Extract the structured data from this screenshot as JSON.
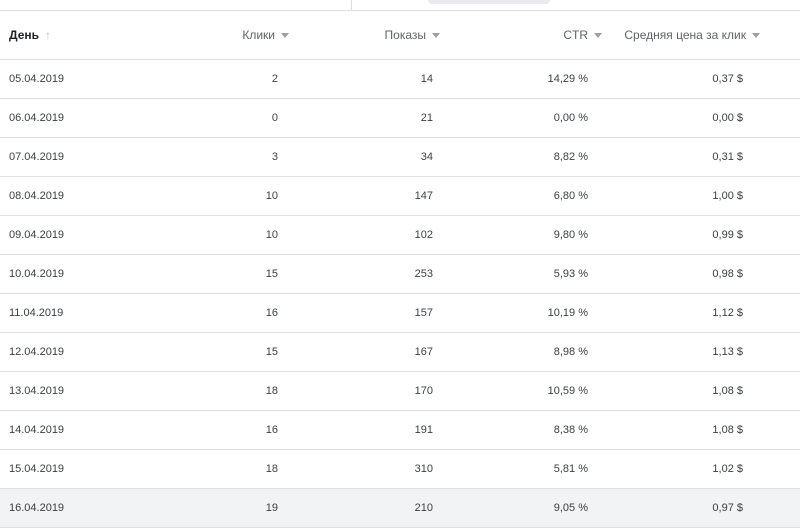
{
  "table": {
    "headers": {
      "day": "День",
      "clicks": "Клики",
      "impressions": "Показы",
      "ctr": "CTR",
      "cpc": "Средняя цена за клик"
    },
    "rows": [
      {
        "day": "05.04.2019",
        "clicks": "2",
        "impressions": "14",
        "ctr": "14,29 %",
        "cpc": "0,37 $"
      },
      {
        "day": "06.04.2019",
        "clicks": "0",
        "impressions": "21",
        "ctr": "0,00 %",
        "cpc": "0,00 $"
      },
      {
        "day": "07.04.2019",
        "clicks": "3",
        "impressions": "34",
        "ctr": "8,82 %",
        "cpc": "0,31 $"
      },
      {
        "day": "08.04.2019",
        "clicks": "10",
        "impressions": "147",
        "ctr": "6,80 %",
        "cpc": "1,00 $"
      },
      {
        "day": "09.04.2019",
        "clicks": "10",
        "impressions": "102",
        "ctr": "9,80 %",
        "cpc": "0,99 $"
      },
      {
        "day": "10.04.2019",
        "clicks": "15",
        "impressions": "253",
        "ctr": "5,93 %",
        "cpc": "0,98 $"
      },
      {
        "day": "11.04.2019",
        "clicks": "16",
        "impressions": "157",
        "ctr": "10,19 %",
        "cpc": "1,12 $"
      },
      {
        "day": "12.04.2019",
        "clicks": "15",
        "impressions": "167",
        "ctr": "8,98 %",
        "cpc": "1,13 $"
      },
      {
        "day": "13.04.2019",
        "clicks": "18",
        "impressions": "170",
        "ctr": "10,59 %",
        "cpc": "1,08 $"
      },
      {
        "day": "14.04.2019",
        "clicks": "16",
        "impressions": "191",
        "ctr": "8,38 %",
        "cpc": "1,08 $"
      },
      {
        "day": "15.04.2019",
        "clicks": "18",
        "impressions": "310",
        "ctr": "5,81 %",
        "cpc": "1,02 $"
      },
      {
        "day": "16.04.2019",
        "clicks": "19",
        "impressions": "210",
        "ctr": "9,05 %",
        "cpc": "0,97 $"
      }
    ]
  },
  "icons": {
    "day_sort": "arrow-up-icon",
    "column_sort": "triangle-down-icon"
  },
  "colors": {
    "header_text": "#5f6368",
    "row_highlight": "#f1f3f4",
    "divider": "#e0e0e0"
  }
}
